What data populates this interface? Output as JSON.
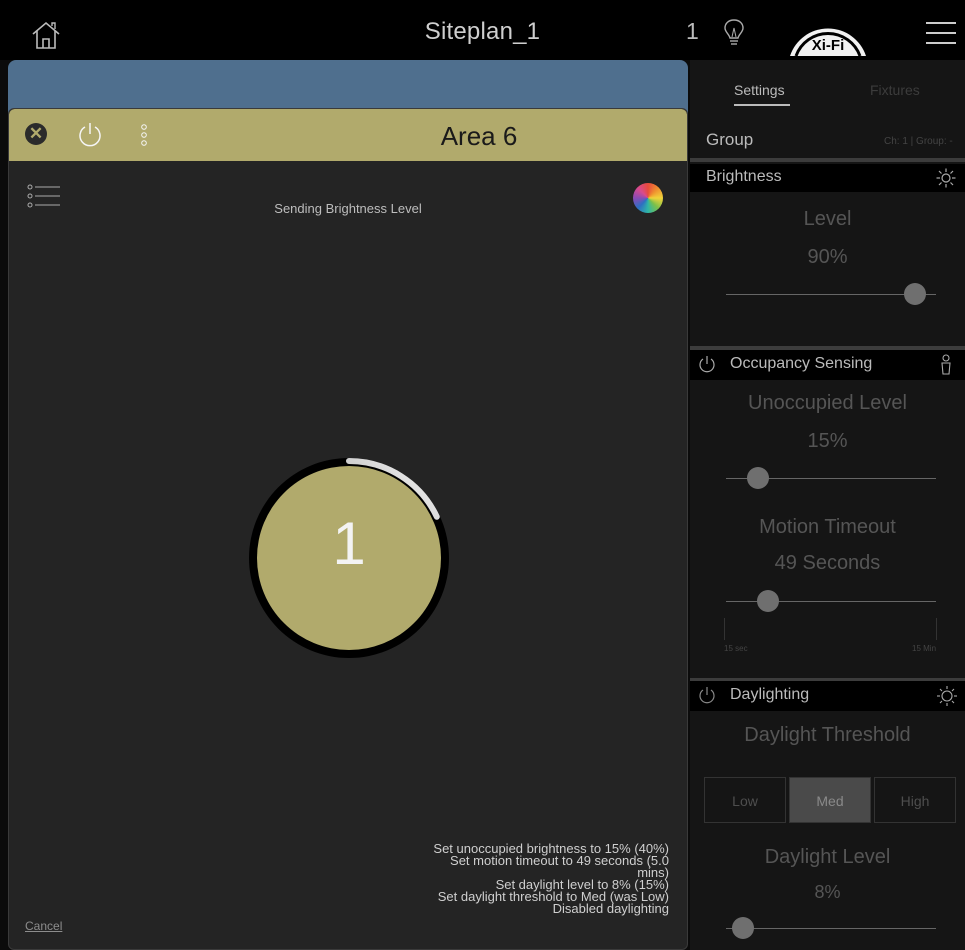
{
  "topbar": {
    "title": "Siteplan_1",
    "count": "1",
    "logo_text": "Xi-Fi",
    "icons": [
      "home-icon",
      "lightbulb-icon",
      "hamburger-menu-icon"
    ]
  },
  "modal": {
    "area_title": "Area 6",
    "status_label": "Sending Brightness Level",
    "dial_value": "1",
    "dial_progress": 0.18,
    "log": [
      "Set unoccupied brightness to 15% (40%)",
      "Set motion timeout to 49 seconds (5.0",
      "mins)",
      "Set daylight level to 8% (15%)",
      "Set daylight threshold to Med (was Low)",
      "Disabled daylighting"
    ],
    "cancel_label": "Cancel",
    "accent_color": "#b1aa6c"
  },
  "rightpanel": {
    "tabs": {
      "settings": "Settings",
      "fixtures": "Fixtures"
    },
    "group": {
      "label": "Group",
      "info": "Ch: 1 | Group: -"
    },
    "brightness": {
      "header": "Brightness",
      "level_label": "Level",
      "level_value": "90%",
      "slider": 0.9
    },
    "occupancy": {
      "header": "Occupancy Sensing",
      "unoccupied_label": "Unoccupied Level",
      "unoccupied_value": "15%",
      "unoccupied_slider": 0.15,
      "timeout_label": "Motion Timeout",
      "timeout_value": "49 Seconds",
      "timeout_slider": 0.2,
      "timeout_min": "15 sec",
      "timeout_max": "15 Min"
    },
    "daylighting": {
      "header": "Daylighting",
      "threshold_label": "Daylight Threshold",
      "threshold_options": [
        "Low",
        "Med",
        "High"
      ],
      "threshold_selected": "Med",
      "level_label": "Daylight Level",
      "level_value": "8%",
      "level_slider": 0.08
    }
  }
}
